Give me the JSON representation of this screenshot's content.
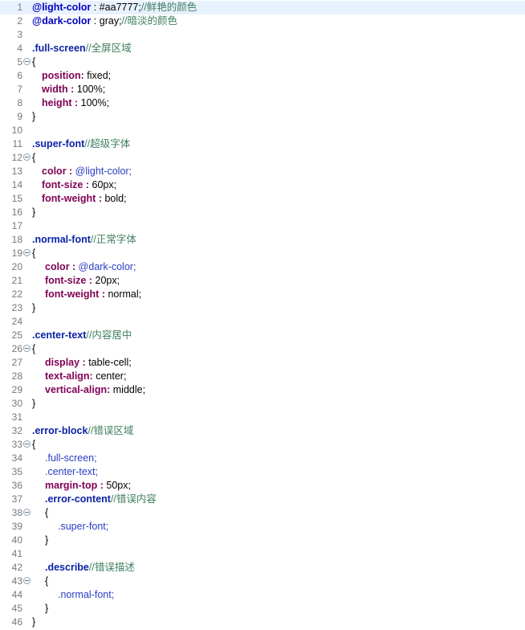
{
  "editor": {
    "lines": [
      {
        "n": "1",
        "current": true,
        "t": [
          {
            "c": "var",
            "s": "@light-color"
          },
          {
            "c": "pl",
            "s": " : #aa7777;"
          },
          {
            "c": "cmt",
            "s": "//鲜艳的颜色"
          }
        ]
      },
      {
        "n": "2",
        "t": [
          {
            "c": "var",
            "s": "@dark-color"
          },
          {
            "c": "pl",
            "s": " : gray;"
          },
          {
            "c": "cmt",
            "s": "//暗淡的颜色"
          }
        ]
      },
      {
        "n": "3",
        "t": []
      },
      {
        "n": "4",
        "t": [
          {
            "c": "sel",
            "s": ".full-screen"
          },
          {
            "c": "cmt",
            "s": "//全屏区域"
          }
        ]
      },
      {
        "n": "5",
        "fold": true,
        "t": [
          {
            "c": "pl",
            "s": "{"
          }
        ]
      },
      {
        "n": "6",
        "indent": 1,
        "t": [
          {
            "c": "prop",
            "s": "position:"
          },
          {
            "c": "pl",
            "s": " fixed;"
          }
        ]
      },
      {
        "n": "7",
        "indent": 1,
        "t": [
          {
            "c": "prop",
            "s": "width :"
          },
          {
            "c": "pl",
            "s": " 100%;"
          }
        ]
      },
      {
        "n": "8",
        "indent": 1,
        "t": [
          {
            "c": "prop",
            "s": "height :"
          },
          {
            "c": "pl",
            "s": " 100%;"
          }
        ]
      },
      {
        "n": "9",
        "t": [
          {
            "c": "pl",
            "s": "}"
          }
        ]
      },
      {
        "n": "10",
        "t": []
      },
      {
        "n": "11",
        "t": [
          {
            "c": "sel",
            "s": ".super-font"
          },
          {
            "c": "cmt",
            "s": "//超级字体"
          }
        ]
      },
      {
        "n": "12",
        "fold": true,
        "t": [
          {
            "c": "pl",
            "s": "{"
          }
        ]
      },
      {
        "n": "13",
        "indent": 1,
        "t": [
          {
            "c": "prop",
            "s": "color :"
          },
          {
            "c": "ref",
            "s": " @light-color;"
          }
        ]
      },
      {
        "n": "14",
        "indent": 1,
        "t": [
          {
            "c": "prop",
            "s": "font-size :"
          },
          {
            "c": "pl",
            "s": " 60px;"
          }
        ]
      },
      {
        "n": "15",
        "indent": 1,
        "t": [
          {
            "c": "prop",
            "s": "font-weight :"
          },
          {
            "c": "pl",
            "s": " bold;"
          }
        ]
      },
      {
        "n": "16",
        "t": [
          {
            "c": "pl",
            "s": "}"
          }
        ]
      },
      {
        "n": "17",
        "t": []
      },
      {
        "n": "18",
        "t": [
          {
            "c": "sel",
            "s": ".normal-font"
          },
          {
            "c": "cmt",
            "s": "//正常字体"
          }
        ]
      },
      {
        "n": "19",
        "fold": true,
        "t": [
          {
            "c": "pl",
            "s": "{"
          }
        ]
      },
      {
        "n": "20",
        "indent": 2,
        "t": [
          {
            "c": "prop",
            "s": "color :"
          },
          {
            "c": "ref",
            "s": " @dark-color;"
          }
        ]
      },
      {
        "n": "21",
        "indent": 2,
        "t": [
          {
            "c": "prop",
            "s": "font-size :"
          },
          {
            "c": "pl",
            "s": " 20px;"
          }
        ]
      },
      {
        "n": "22",
        "indent": 2,
        "t": [
          {
            "c": "prop",
            "s": "font-weight :"
          },
          {
            "c": "pl",
            "s": " normal;"
          }
        ]
      },
      {
        "n": "23",
        "t": [
          {
            "c": "pl",
            "s": "}"
          }
        ]
      },
      {
        "n": "24",
        "t": []
      },
      {
        "n": "25",
        "t": [
          {
            "c": "sel",
            "s": ".center-text"
          },
          {
            "c": "cmt",
            "s": "//内容居中"
          }
        ]
      },
      {
        "n": "26",
        "fold": true,
        "t": [
          {
            "c": "pl",
            "s": "{"
          }
        ]
      },
      {
        "n": "27",
        "indent": 2,
        "t": [
          {
            "c": "prop",
            "s": "display :"
          },
          {
            "c": "pl",
            "s": " table-cell;"
          }
        ]
      },
      {
        "n": "28",
        "indent": 2,
        "t": [
          {
            "c": "prop",
            "s": "text-align:"
          },
          {
            "c": "pl",
            "s": " center;"
          }
        ]
      },
      {
        "n": "29",
        "indent": 2,
        "t": [
          {
            "c": "prop",
            "s": "vertical-align:"
          },
          {
            "c": "pl",
            "s": " middle;"
          }
        ]
      },
      {
        "n": "30",
        "t": [
          {
            "c": "pl",
            "s": "}"
          }
        ]
      },
      {
        "n": "31",
        "t": []
      },
      {
        "n": "32",
        "t": [
          {
            "c": "sel",
            "s": ".error-block"
          },
          {
            "c": "cmt",
            "s": "//错误区域"
          }
        ]
      },
      {
        "n": "33",
        "fold": true,
        "t": [
          {
            "c": "pl",
            "s": "{"
          }
        ]
      },
      {
        "n": "34",
        "indent": 2,
        "t": [
          {
            "c": "ref",
            "s": ".full-screen;"
          }
        ]
      },
      {
        "n": "35",
        "indent": 2,
        "t": [
          {
            "c": "ref",
            "s": ".center-text;"
          }
        ]
      },
      {
        "n": "36",
        "indent": 2,
        "t": [
          {
            "c": "prop",
            "s": "margin-top :"
          },
          {
            "c": "pl",
            "s": " 50px;"
          }
        ]
      },
      {
        "n": "37",
        "indent": 2,
        "t": [
          {
            "c": "sel",
            "s": ".error-content"
          },
          {
            "c": "cmt",
            "s": "//错误内容"
          }
        ]
      },
      {
        "n": "38",
        "fold": true,
        "indent": 2,
        "t": [
          {
            "c": "pl",
            "s": "{"
          }
        ]
      },
      {
        "n": "39",
        "indent": 3,
        "t": [
          {
            "c": "ref",
            "s": ".super-font;"
          }
        ]
      },
      {
        "n": "40",
        "indent": 2,
        "t": [
          {
            "c": "pl",
            "s": "}"
          }
        ]
      },
      {
        "n": "41",
        "t": []
      },
      {
        "n": "42",
        "indent": 2,
        "t": [
          {
            "c": "sel",
            "s": ".describe"
          },
          {
            "c": "cmt",
            "s": "//错误描述"
          }
        ]
      },
      {
        "n": "43",
        "fold": true,
        "indent": 2,
        "t": [
          {
            "c": "pl",
            "s": "{"
          }
        ]
      },
      {
        "n": "44",
        "indent": 3,
        "t": [
          {
            "c": "ref",
            "s": ".normal-font;"
          }
        ]
      },
      {
        "n": "45",
        "indent": 2,
        "t": [
          {
            "c": "pl",
            "s": "}"
          }
        ]
      },
      {
        "n": "46",
        "t": [
          {
            "c": "pl",
            "s": "}"
          }
        ]
      }
    ]
  }
}
